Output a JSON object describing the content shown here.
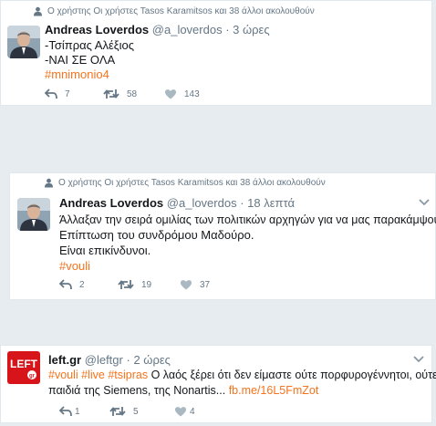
{
  "tweets": [
    {
      "social_context": "Ο χρήστης Οι χρήστες Tasos Karamitsos και 38 άλλοι ακολουθούν",
      "fullname": "Andreas Loverdos",
      "username": "@a_loverdos",
      "dot": "·",
      "time": "3 ώρες",
      "text_lines": [
        "-Τσίπρας Αλέξιος",
        "-ΝΑΙ ΣΕ ΟΛΑ"
      ],
      "hashtag_line": "#mnimonio4",
      "reply_count": "7",
      "retweet_count": "58",
      "like_count": "143"
    },
    {
      "social_context": "Ο χρήστης Οι χρήστες Tasos Karamitsos και 38 άλλοι ακολουθούν",
      "fullname": "Andreas Loverdos",
      "username": "@a_loverdos",
      "dot": "·",
      "time": "18 λεπτά",
      "text_lines": [
        "Άλλαξαν την σειρά ομιλίας των πολιτικών αρχηγών για να μας παρακάμψουν.",
        "Επίπτωση του συνδρόμου Μαδούρο.",
        "Είναι επικίνδυνοι."
      ],
      "hashtag_line": "#vouli",
      "reply_count": "2",
      "retweet_count": "19",
      "like_count": "37"
    },
    {
      "fullname": "left.gr",
      "username": "@leftgr",
      "dot": "·",
      "time": "2 ώρες",
      "hashtags": [
        "#vouli",
        "#live",
        "#tsipras"
      ],
      "text_line1": " Ο λαός ξέρει ότι δεν είμαστε ούτε πορφυρογέννητοι, ούτε",
      "text_line2": "παιδιά της Siemens, της Nonartis... ",
      "link": "fb.me/16L5FmZot",
      "avatar_text": "LEFT",
      "avatar_sub": "gr",
      "reply_count": "1",
      "retweet_count": "5",
      "like_count": "4"
    }
  ],
  "colors": {
    "accent": "#f5731d",
    "background": "#e6ecf0",
    "muted": "#657786",
    "left_red": "#d7141a"
  },
  "icons": [
    "person-icon",
    "reply-icon",
    "retweet-icon",
    "heart-icon",
    "chevron-down-icon"
  ]
}
